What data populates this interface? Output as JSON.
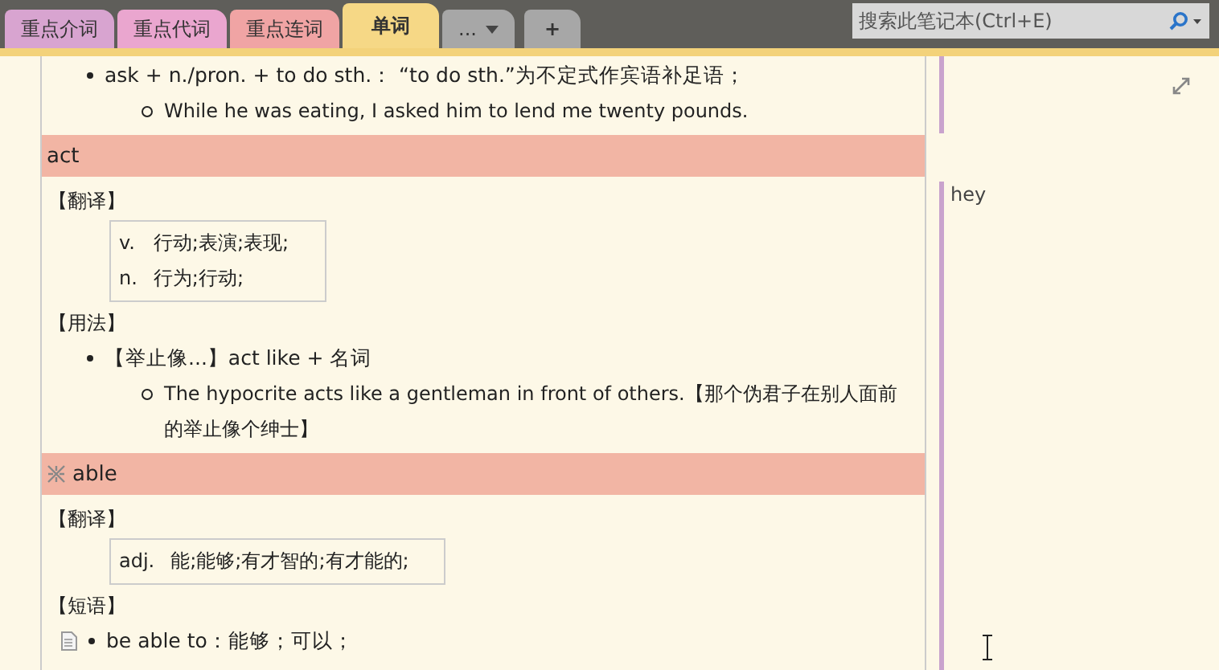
{
  "tabs": [
    {
      "label": "重点介词",
      "color": "#d8a4d0",
      "selected": false
    },
    {
      "label": "重点代词",
      "color": "#eaa6cf",
      "selected": false
    },
    {
      "label": "重点连词",
      "color": "#f0a4a4",
      "selected": false
    },
    {
      "label": "单词",
      "color": "#f6d886",
      "selected": true
    }
  ],
  "overflow_tab": {
    "label": "..."
  },
  "new_tab": {
    "label": "+"
  },
  "search": {
    "placeholder": "搜索此笔记本(Ctrl+E)"
  },
  "content": [
    {
      "kind": "bullet",
      "text": "ask + n./pron. + to do sth.： “to do sth.”为不定式作宾语补足语；"
    },
    {
      "kind": "sub_bullet",
      "text": "While he was eating, I asked him to lend me twenty pounds."
    },
    {
      "kind": "entry_header",
      "text": "act",
      "marked": false
    },
    {
      "kind": "label",
      "text": "【翻译】"
    },
    {
      "kind": "definitions",
      "rows": [
        {
          "pos": "v.",
          "meaning": "行动;表演;表现;"
        },
        {
          "pos": "n.",
          "meaning": "行为;行动;"
        }
      ]
    },
    {
      "kind": "label",
      "text": "【用法】"
    },
    {
      "kind": "bullet",
      "text": "【举止像...】act like + 名词"
    },
    {
      "kind": "sub_bullet",
      "text": "The hypocrite acts like a gentleman in front of others.【那个伪君子在别人面前的举止像个绅士】"
    },
    {
      "kind": "entry_header",
      "text": "able",
      "marked": true
    },
    {
      "kind": "label",
      "text": "【翻译】"
    },
    {
      "kind": "definitions",
      "rows": [
        {
          "pos": "adj.",
          "meaning": "能;能够;有才智的;有才能的;"
        }
      ]
    },
    {
      "kind": "label",
      "text": "【短语】"
    },
    {
      "kind": "bullet",
      "text": "be able to：能够；可以；",
      "note_icon": true
    }
  ],
  "side_note": {
    "text": "hey"
  }
}
